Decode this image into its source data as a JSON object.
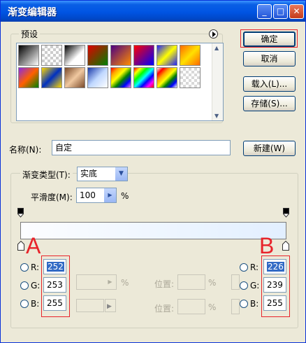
{
  "window": {
    "title": "渐变编辑器"
  },
  "titlebar_buttons": {
    "minimize": "_",
    "maximize": "□",
    "close": "✕"
  },
  "presets": {
    "legend": "预设",
    "menu_icon": "circle-arrow-icon",
    "swatches_row1": [
      "linear-gradient(135deg,#000,#fff)",
      "repeating-conic-gradient(#ccc 0 25%,#fff 0 50%) 0 0/8px 8px",
      "linear-gradient(135deg,#000,#fff 60%,#fff)",
      "linear-gradient(135deg,#e00000,#008000)",
      "linear-gradient(135deg,#4b0082,#ff8c00)",
      "linear-gradient(135deg,#ff0000,#0000ff)",
      "linear-gradient(135deg,#2020ff,#ffff00 50%,#2020ff)",
      "linear-gradient(135deg,#ff6a00,#ffe000 50%,#ff6a00)"
    ],
    "swatches_row2": [
      "linear-gradient(135deg,#8a2be2,#ff6000 50%,#008000)",
      "linear-gradient(135deg,#ffd800,#0030c0 50%,#ffd800)",
      "linear-gradient(135deg,#7a4a2a,#f0c8a0 50%,#7a4a2a)",
      "linear-gradient(135deg,#1a3aaa,#c0d8ff 50%,#fff)",
      "linear-gradient(135deg,red,orange,yellow,green,blue,violet)",
      "linear-gradient(135deg,red,yellow,lime,cyan,blue,magenta,red)",
      "linear-gradient(135deg,#fff,red,orange,yellow,green,blue,#fff)",
      "repeating-conic-gradient(#d8d8d8 0 25%,#fff 0 50%) 0 0/8px 8px"
    ]
  },
  "buttons": {
    "ok": "确定",
    "cancel": "取消",
    "load": "载入(L)...",
    "save": "存储(S)...",
    "new": "新建(W)"
  },
  "name": {
    "label": "名称(N):",
    "value": "自定"
  },
  "gradient_type": {
    "label": "渐变类型(T):",
    "value": "实底"
  },
  "smoothness": {
    "label": "平滑度(M):",
    "value": "100",
    "unit": "%"
  },
  "gradient_bar": {
    "left_color": "#fcfdff",
    "right_color": "#e2efff"
  },
  "annotations": {
    "left": "A",
    "right": "B"
  },
  "left_rgb": {
    "r_label": "R:",
    "g_label": "G:",
    "b_label": "B:",
    "r": "252",
    "g": "253",
    "b": "255"
  },
  "right_rgb": {
    "r_label": "R:",
    "g_label": "G:",
    "b_label": "B:",
    "r": "226",
    "g": "239",
    "b": "255"
  },
  "stop_controls": {
    "position_label": "位置:",
    "percent": "%"
  }
}
